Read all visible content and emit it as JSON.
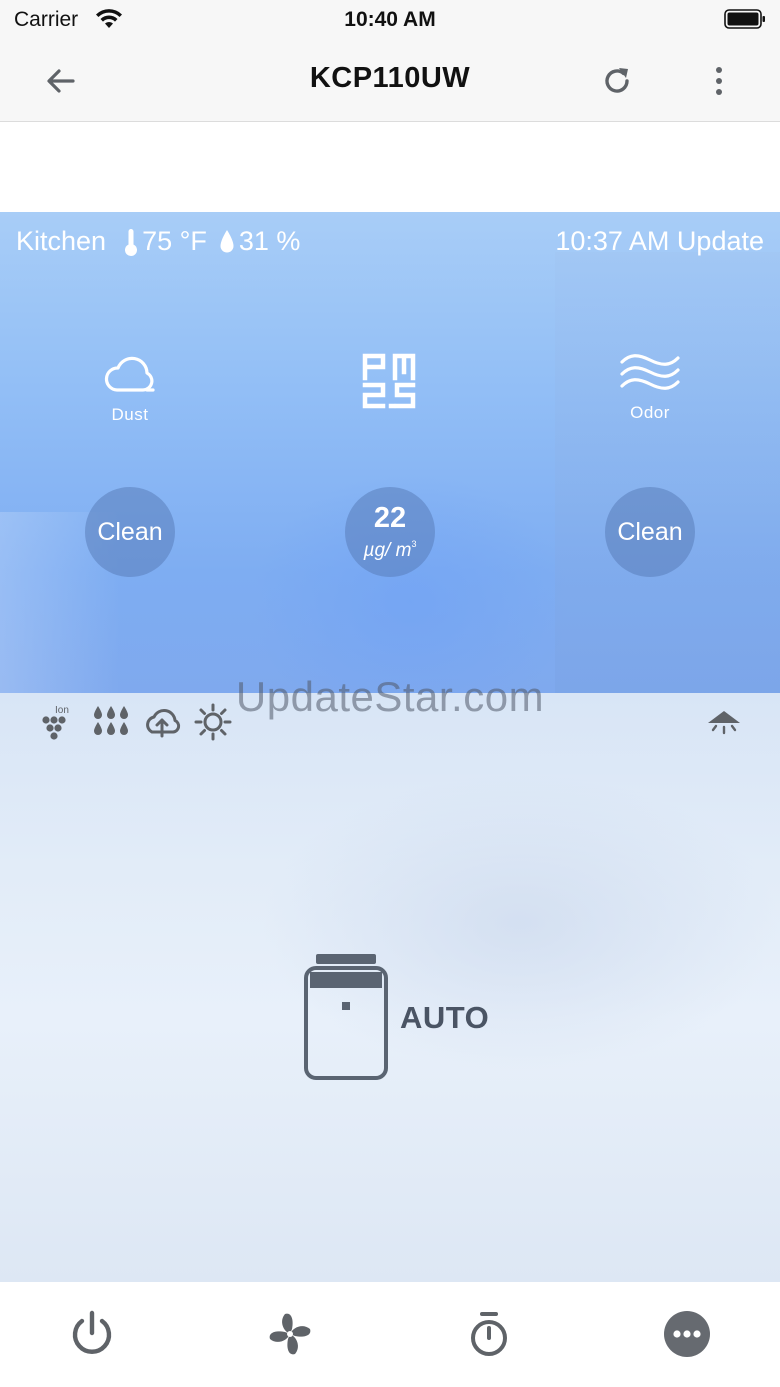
{
  "status_bar": {
    "carrier": "Carrier",
    "time": "10:40 AM"
  },
  "nav": {
    "title": "KCP110UW",
    "icons": [
      "back-arrow-icon",
      "refresh-icon",
      "more-vertical-icon"
    ]
  },
  "air_panel": {
    "room": "Kitchen",
    "temperature": "75 °F",
    "humidity": "31 %",
    "update": "10:37 AM Update",
    "sensors": {
      "dust": {
        "label": "Dust",
        "value": "Clean"
      },
      "pm25": {
        "value": "22",
        "unit": "µg/ m",
        "unit_sup": "3"
      },
      "odor": {
        "label": "Odor",
        "value": "Clean"
      }
    }
  },
  "watermark": "UpdateStar.com",
  "status_icons": [
    "ion-icon",
    "humidify-drops-icon",
    "cloud-sync-icon",
    "sun-icon",
    "light-icon"
  ],
  "ion_label": "Ion",
  "mode": {
    "label": "AUTO"
  },
  "toolbar": {
    "icons": [
      "power-icon",
      "fan-icon",
      "timer-icon",
      "more-icon"
    ]
  },
  "colors": {
    "panel_top": "#a8cdf7",
    "panel_bottom": "#7fa9ee",
    "icon_gray": "#5f6368",
    "mode_text": "#4a5464"
  }
}
